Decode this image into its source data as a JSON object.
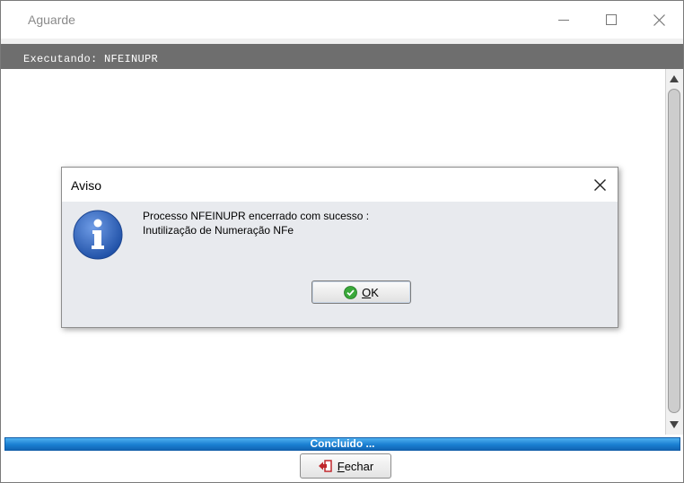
{
  "window": {
    "title": "Aguarde",
    "controls": {
      "minimize_icon": "minimize-icon",
      "maximize_icon": "maximize-icon",
      "close_icon": "close-icon"
    }
  },
  "banner": {
    "text": "Executando: NFEINUPR"
  },
  "progress": {
    "label": "Concluido ...",
    "fraction": 1.0,
    "color": "#1a7fd2"
  },
  "footer": {
    "close_button": {
      "label_first": "F",
      "label_rest": "echar",
      "icon": "exit-icon"
    }
  },
  "dialog": {
    "title": "Aviso",
    "icon": "info-icon",
    "message_line1": "Processo NFEINUPR encerrado com sucesso :",
    "message_line2": "Inutilização de Numeração NFe",
    "ok_button": {
      "label_first": "O",
      "label_rest": "K",
      "icon": "check-icon"
    }
  },
  "colors": {
    "banner_bg": "#6e6e6e",
    "dialog_bg": "#e8eaee",
    "info_blue": "#2b62b8",
    "check_green": "#3aa83a"
  }
}
